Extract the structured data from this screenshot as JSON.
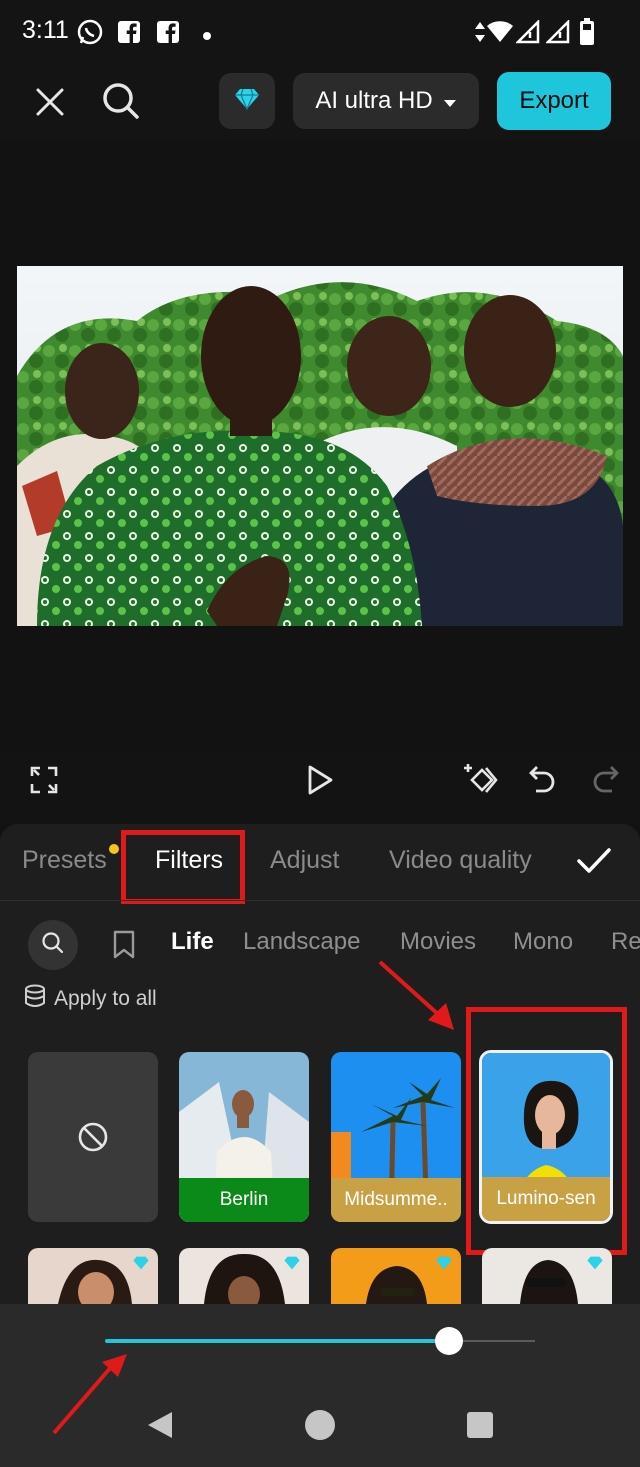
{
  "status_bar": {
    "time": "3:11",
    "icons": [
      "whatsapp-icon",
      "facebook-icon",
      "facebook-icon",
      "dot-icon",
      "data-arrows-icon",
      "wifi-icon",
      "signal-icon",
      "signal-icon",
      "battery-icon"
    ]
  },
  "toolbar": {
    "close_icon": "close-icon",
    "search_icon": "search-icon",
    "premium_icon": "diamond-icon",
    "quality_label": "AI ultra HD",
    "export_label": "Export",
    "accent_color": "#1ec6dc"
  },
  "playback": {
    "icons": [
      "fullscreen-icon",
      "play-icon",
      "keyframe-icon",
      "undo-icon",
      "redo-icon"
    ]
  },
  "tabs": [
    {
      "label": "Presets",
      "active": false
    },
    {
      "label": "Filters",
      "active": true
    },
    {
      "label": "Adjust",
      "active": false
    },
    {
      "label": "Video quality",
      "active": false
    }
  ],
  "categories": [
    "Life",
    "Landscape",
    "Movies",
    "Mono",
    "Re"
  ],
  "apply_all_label": "Apply to all",
  "filters": [
    {
      "label": "",
      "type": "none"
    },
    {
      "label": "Berlin"
    },
    {
      "label": "Midsumme.."
    },
    {
      "label": "Lumino-sen",
      "selected": true
    }
  ],
  "slider": {
    "value_fraction": 0.8
  },
  "nav": {
    "icons": [
      "back-icon",
      "home-icon",
      "recents-icon"
    ]
  }
}
